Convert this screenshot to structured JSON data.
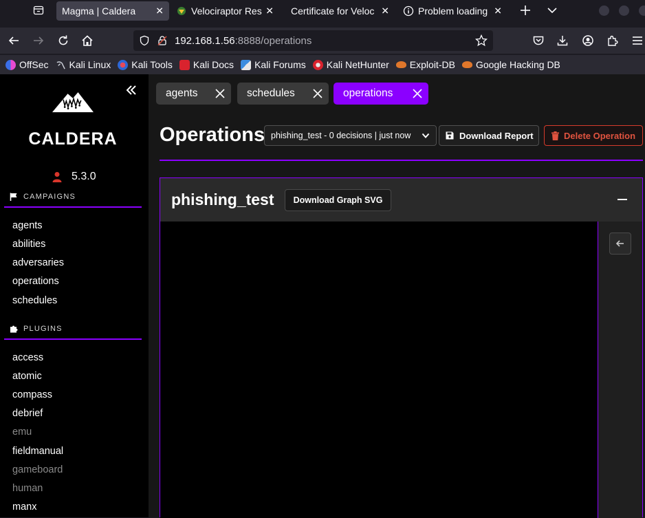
{
  "browser": {
    "tabs": [
      {
        "title": "Magma | Caldera",
        "active": true
      },
      {
        "title": "Velociraptor Res",
        "active": false
      },
      {
        "title": "Certificate for Veloc",
        "active": false
      },
      {
        "title": "Problem loading",
        "active": false
      }
    ],
    "url_host": "192.168.1.56",
    "url_path": ":8888/operations",
    "bookmarks": [
      {
        "label": "OffSec",
        "icon": "offsec-icon"
      },
      {
        "label": "Kali Linux",
        "icon": "kali-dragon-icon"
      },
      {
        "label": "Kali Tools",
        "icon": "kali-tools-icon"
      },
      {
        "label": "Kali Docs",
        "icon": "kali-docs-icon"
      },
      {
        "label": "Kali Forums",
        "icon": "kali-forums-icon"
      },
      {
        "label": "Kali NetHunter",
        "icon": "nethunter-icon"
      },
      {
        "label": "Exploit-DB",
        "icon": "exploit-db-icon"
      },
      {
        "label": "Google Hacking DB",
        "icon": "ghdb-icon"
      }
    ]
  },
  "sidebar": {
    "logo_text": "CALDERA",
    "version": "5.3.0",
    "campaigns_title": "CAMPAIGNS",
    "campaign_links": [
      "agents",
      "abilities",
      "adversaries",
      "operations",
      "schedules"
    ],
    "plugins_title": "PLUGINS",
    "plugin_links": [
      {
        "label": "access",
        "enabled": true
      },
      {
        "label": "atomic",
        "enabled": true
      },
      {
        "label": "compass",
        "enabled": true
      },
      {
        "label": "debrief",
        "enabled": true
      },
      {
        "label": "emu",
        "enabled": false
      },
      {
        "label": "fieldmanual",
        "enabled": true
      },
      {
        "label": "gameboard",
        "enabled": false
      },
      {
        "label": "human",
        "enabled": false
      },
      {
        "label": "manx",
        "enabled": true
      }
    ]
  },
  "main": {
    "open_tabs": [
      "agents",
      "schedules",
      "operations"
    ],
    "active_tab": "operations",
    "page_title": "Operations",
    "selected_operation": "phishing_test - 0 decisions | just now",
    "download_report_label": "Download Report",
    "delete_operation_label": "Delete Operation",
    "operation_name": "phishing_test",
    "download_graph_label": "Download Graph SVG"
  },
  "colors": {
    "accent": "#8b00ff",
    "danger": "#e0533f",
    "background": "#171717"
  }
}
